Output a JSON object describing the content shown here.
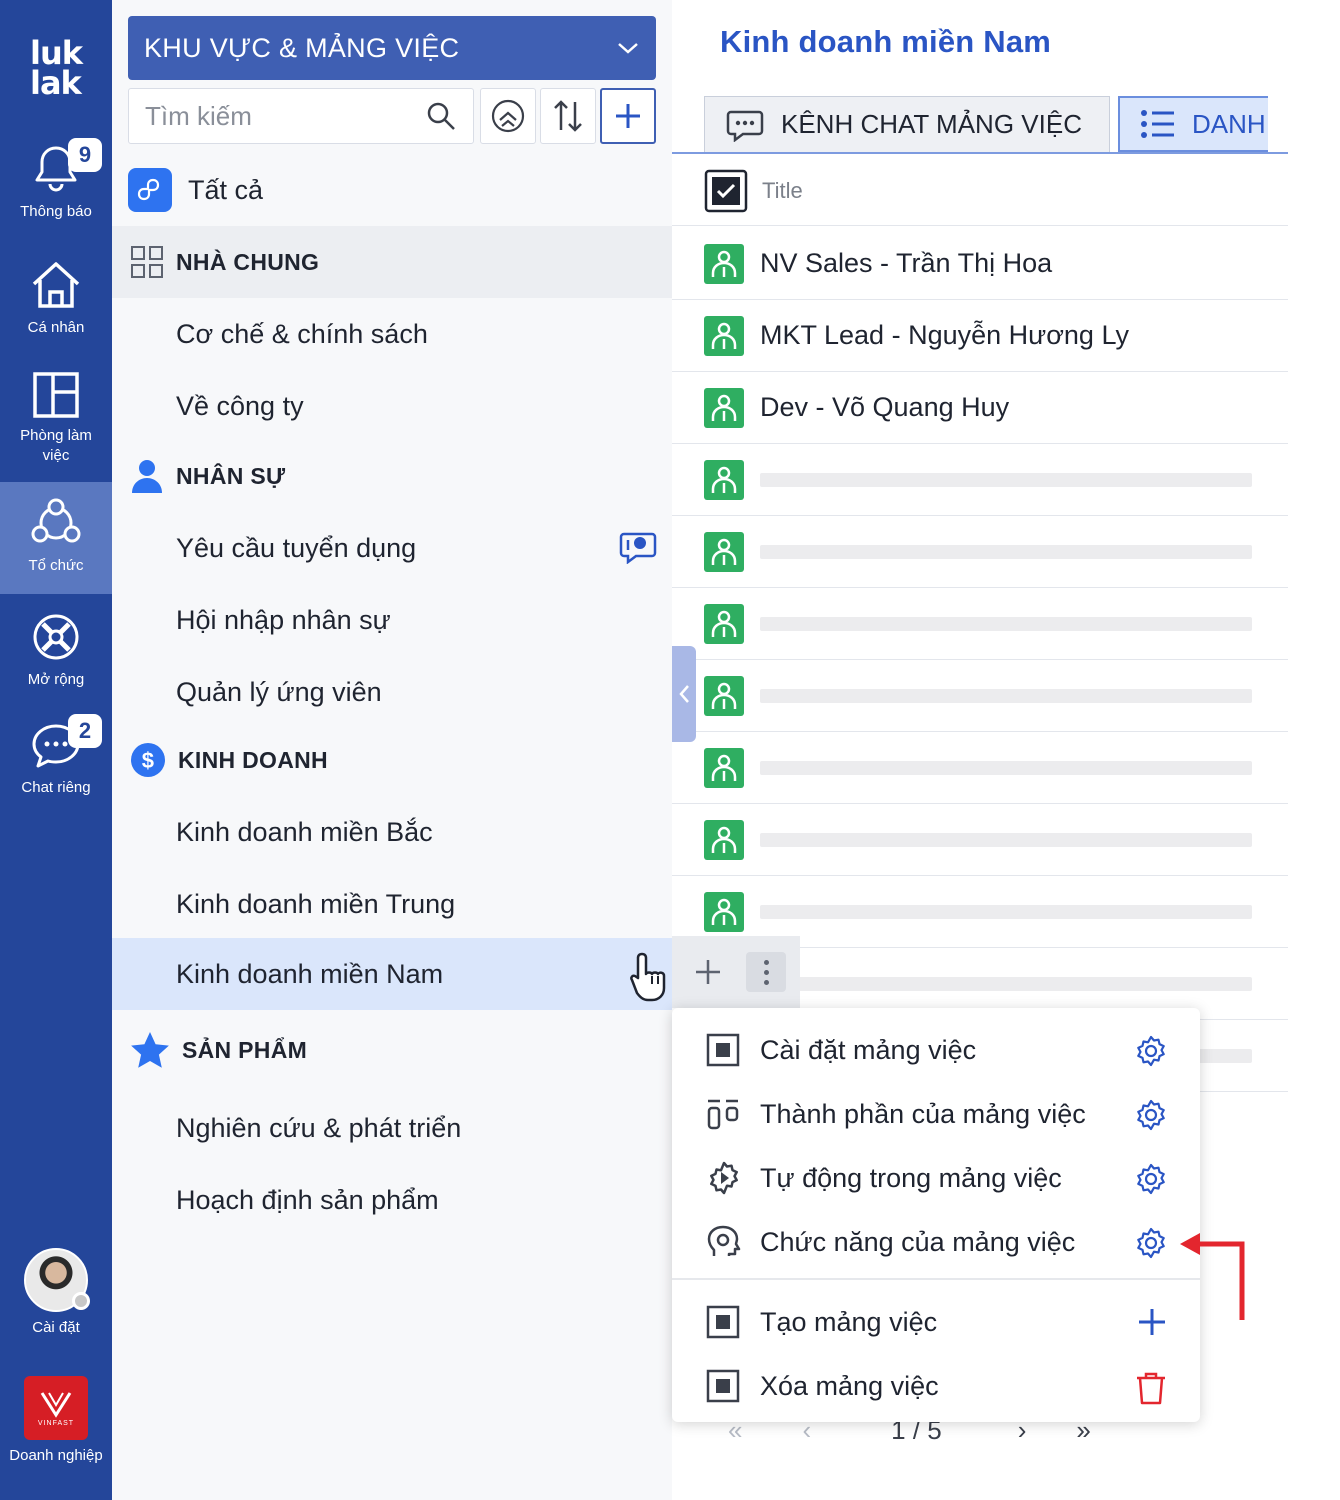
{
  "rail": {
    "logo_line1": "luk",
    "logo_line2": "lak",
    "items": [
      {
        "label": "Thông báo",
        "badge": "9",
        "icon": "bell-icon"
      },
      {
        "label": "Cá nhân",
        "icon": "home-icon"
      },
      {
        "label": "Phòng làm việc",
        "icon": "layout-icon"
      },
      {
        "label": "Tổ chức",
        "icon": "organization-icon",
        "active": true
      },
      {
        "label": "Mở rộng",
        "icon": "extension-icon"
      },
      {
        "label": "Chat riêng",
        "badge": "2",
        "icon": "chat-icon"
      }
    ],
    "settings_label": "Cài đặt",
    "enterprise_label": "Doanh nghiệp",
    "enterprise_logo_text": "VINFAST"
  },
  "sidebar": {
    "area_select": "KHU VỰC & MẢNG VIỆC",
    "search_placeholder": "Tìm kiếm",
    "all_label": "Tất cả",
    "groups": [
      {
        "label": "NHÀ CHUNG",
        "icon": "grid-icon",
        "items": [
          "Cơ chế & chính sách",
          "Về công ty"
        ]
      },
      {
        "label": "NHÂN SỰ",
        "icon": "person-icon",
        "items": [
          "Yêu cầu tuyển dụng",
          "Hội nhập nhân sự",
          "Quản lý ứng viên"
        ]
      },
      {
        "label": "KINH DOANH",
        "icon": "dollar-icon",
        "items": [
          "Kinh doanh miền Bắc",
          "Kinh doanh miền Trung",
          "Kinh doanh miền Nam"
        ]
      },
      {
        "label": "SẢN PHẨM",
        "icon": "star-icon",
        "items": [
          "Nghiên cứu & phát triển",
          "Hoạch định sản phẩm"
        ]
      }
    ],
    "selected": "Kinh doanh miền Nam"
  },
  "main": {
    "title": "Kinh doanh miền Nam",
    "tabs": [
      {
        "label": "KÊNH CHAT MẢNG VIỆC"
      },
      {
        "label": "DANH"
      }
    ],
    "column_title": "Title",
    "rows": [
      "NV Sales - Trần Thị Hoa",
      "MKT Lead - Nguyễn Hương Ly",
      "Dev - Võ Quang Huy"
    ],
    "pager": {
      "page": "1 / 5",
      "first": "«",
      "prev": "‹",
      "next": "›",
      "last": "»"
    }
  },
  "menu": {
    "items": [
      {
        "label": "Cài đặt mảng việc",
        "action": "gear"
      },
      {
        "label": "Thành phần của mảng việc",
        "action": "gear"
      },
      {
        "label": "Tự động trong mảng việc",
        "action": "gear"
      },
      {
        "label": "Chức năng của mảng việc",
        "action": "gear"
      },
      {
        "label": "Tạo mảng việc",
        "action": "plus"
      },
      {
        "label": "Xóa mảng việc",
        "action": "trash"
      }
    ]
  },
  "colors": {
    "rail_bg": "#24469a",
    "accent": "#2a55c4",
    "selected_bg": "#dae6fb",
    "row_icon": "#2fae61",
    "danger": "#e3262e"
  }
}
